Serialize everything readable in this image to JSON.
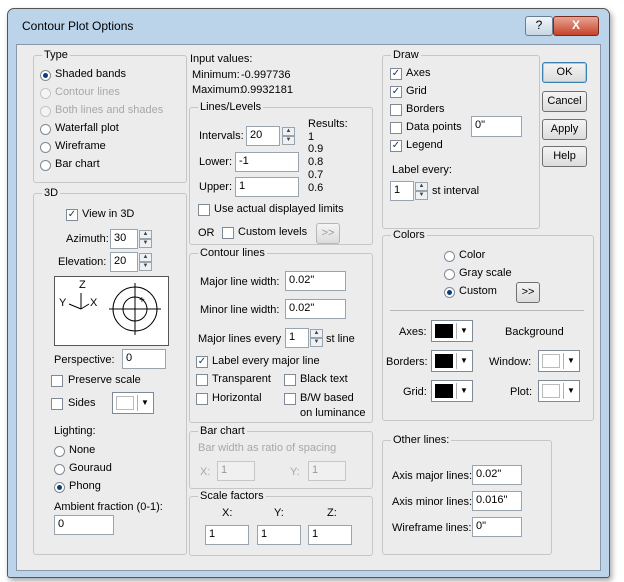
{
  "window": {
    "title": "Contour Plot Options"
  },
  "titlebar_buttons": {
    "help": "?",
    "close": "X"
  },
  "buttons": {
    "ok": "OK",
    "cancel": "Cancel",
    "apply": "Apply",
    "help": "Help"
  },
  "type": {
    "title": "Type",
    "options": [
      "Shaded bands",
      "Contour lines",
      "Both lines and shades",
      "Waterfall plot",
      "Wireframe",
      "Bar chart"
    ],
    "selected": "Shaded bands"
  },
  "threed": {
    "title": "3D",
    "view_in_3d": "View in 3D",
    "azimuth_label": "Azimuth:",
    "azimuth": "30",
    "elevation_label": "Elevation:",
    "elevation": "20",
    "axis_z": "Z",
    "axis_y": "Y",
    "axis_x": "X",
    "perspective_label": "Perspective:",
    "perspective": "0",
    "preserve_scale": "Preserve scale",
    "sides": "Sides",
    "lighting_label": "Lighting:",
    "lighting_options": [
      "None",
      "Gouraud",
      "Phong"
    ],
    "lighting_selected": "Phong",
    "ambient_label": "Ambient fraction (0-1):",
    "ambient": "0"
  },
  "input_values": {
    "title": "Input values:",
    "minimum_label": "Minimum:",
    "minimum": "-0.997736",
    "maximum_label": "Maximum:",
    "maximum": "0.9932181"
  },
  "lines_levels": {
    "title": "Lines/Levels",
    "intervals_label": "Intervals:",
    "intervals": "20",
    "lower_label": "Lower:",
    "lower": "-1",
    "upper_label": "Upper:",
    "upper": "1",
    "results_label": "Results:",
    "results": [
      "1",
      "0.9",
      "0.8",
      "0.7",
      "0.6"
    ],
    "use_actual": "Use actual displayed limits",
    "or_label": "OR",
    "custom_levels": "Custom levels",
    "more": ">>"
  },
  "contour_lines": {
    "title": "Contour lines",
    "major_width_label": "Major line width:",
    "major_width": "0.02\"",
    "minor_width_label": "Minor line width:",
    "minor_width": "0.02\"",
    "major_every_label": "Major lines every",
    "major_every": "1",
    "st_line": "st line",
    "label_every_major": "Label every major line",
    "transparent": "Transparent",
    "black_text": "Black text",
    "horizontal": "Horizontal",
    "bw_based_1": "B/W based",
    "bw_based_2": "on luminance"
  },
  "bar_chart": {
    "title": "Bar chart",
    "width_ratio": "Bar width as ratio of spacing",
    "x_label": "X:",
    "x": "1",
    "y_label": "Y:",
    "y": "1"
  },
  "scale_factors": {
    "title": "Scale factors",
    "x_label": "X:",
    "x": "1",
    "y_label": "Y:",
    "y": "1",
    "z_label": "Z:",
    "z": "1"
  },
  "draw": {
    "title": "Draw",
    "axes": "Axes",
    "grid": "Grid",
    "borders": "Borders",
    "data_points": "Data points",
    "data_points_size": "0\"",
    "legend": "Legend",
    "label_every": "Label every:",
    "label_every_value": "1",
    "st_interval": "st interval"
  },
  "colors": {
    "title": "Colors",
    "options": [
      "Color",
      "Gray scale",
      "Custom"
    ],
    "selected": "Custom",
    "more": ">>",
    "axes_label": "Axes:",
    "borders_label": "Borders:",
    "grid_label": "Grid:",
    "background_label": "Background",
    "window_label": "Window:",
    "plot_label": "Plot:",
    "axes_color": "#000000",
    "borders_color": "#000000",
    "grid_color": "#000000",
    "window_color": "#ffffff",
    "plot_color": "#ffffff"
  },
  "other_lines": {
    "title": "Other lines:",
    "axis_major_label": "Axis major lines:",
    "axis_major": "0.02\"",
    "axis_minor_label": "Axis minor lines:",
    "axis_minor": "0.016\"",
    "wireframe_label": "Wireframe lines:",
    "wireframe": "0\""
  },
  "colors_theme": {
    "accent": "#0d3c7a",
    "frame": "#bcd4ea"
  }
}
